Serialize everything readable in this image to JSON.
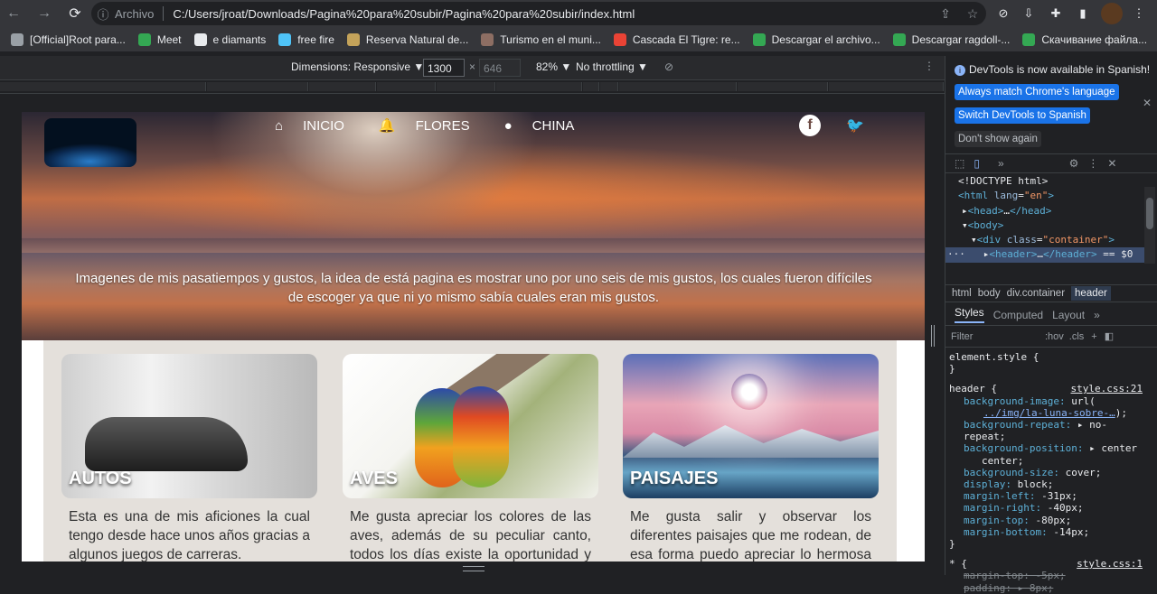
{
  "browser": {
    "proto_label": "Archivo",
    "url": "C:/Users/jroat/Downloads/Pagina%20para%20subir/Pagina%20para%20subir/index.html"
  },
  "bookmarks": [
    {
      "label": "[Official]Root para...",
      "color": "#9aa0a6"
    },
    {
      "label": "Meet",
      "color": "#34a853"
    },
    {
      "label": "e diamants",
      "color": "#e8eaed"
    },
    {
      "label": "free fire",
      "color": "#4fc3f7"
    },
    {
      "label": "Reserva Natural de...",
      "color": "#c4a35a"
    },
    {
      "label": "Turismo en el muni...",
      "color": "#8d6e63"
    },
    {
      "label": "Cascada El Tigre: re...",
      "color": "#ea4335"
    },
    {
      "label": "Descargar el archivo...",
      "color": "#34a853"
    },
    {
      "label": "Descargar ragdoll-...",
      "color": "#34a853"
    },
    {
      "label": "Скачивание файла...",
      "color": "#34a853"
    }
  ],
  "device_toolbar": {
    "dimensions": "Dimensions: Responsive ▼",
    "width": "1300",
    "x": "×",
    "height": "646",
    "zoom": "82% ▼",
    "throttling": "No throttling ▼"
  },
  "page": {
    "nav": [
      {
        "icon": "home-icon",
        "glyph": "⌂",
        "label": "INICIO"
      },
      {
        "icon": "bell-icon",
        "glyph": "🔔",
        "label": "FLORES"
      },
      {
        "icon": "user-icon",
        "glyph": "●",
        "label": "CHINA"
      }
    ],
    "hero_text": "Imagenes de mis pasatiempos y gustos, la idea de está pagina es mostrar uno por uno seis de mis gustos, los cuales fueron difíciles de escoger ya que ni yo mismo sabía cuales eran mis gustos.",
    "cards": [
      {
        "title": "AUTOS",
        "desc": "Esta es una de mis aficiones la cual tengo desde hace unos años gracias a algunos juegos de carreras."
      },
      {
        "title": "AVES",
        "desc": "Me gusta apreciar los colores de las aves, además de su peculiar canto, todos los días existe la oportunidad y la"
      },
      {
        "title": "PAISAJES",
        "desc": "Me gusta salir y observar los diferentes paisajes que me rodean, de esa forma puedo apreciar lo hermosa que es la"
      }
    ]
  },
  "devtools": {
    "banner_msg": "DevTools is now available in Spanish!",
    "btn_match": "Always match Chrome's language",
    "btn_switch": "Switch DevTools to Spanish",
    "btn_dont": "Don't show again",
    "breadcrumbs": [
      "html",
      "body",
      "div.container",
      "header"
    ],
    "subtabs": [
      "Styles",
      "Computed",
      "Layout",
      "»"
    ],
    "filter_placeholder": "Filter",
    "hov": ":hov",
    "cls": ".cls",
    "element_style": "element.style {",
    "rule_selector": "header {",
    "rule_source": "style.css:21",
    "star_selector": "* {",
    "star_source": "style.css:1"
  }
}
